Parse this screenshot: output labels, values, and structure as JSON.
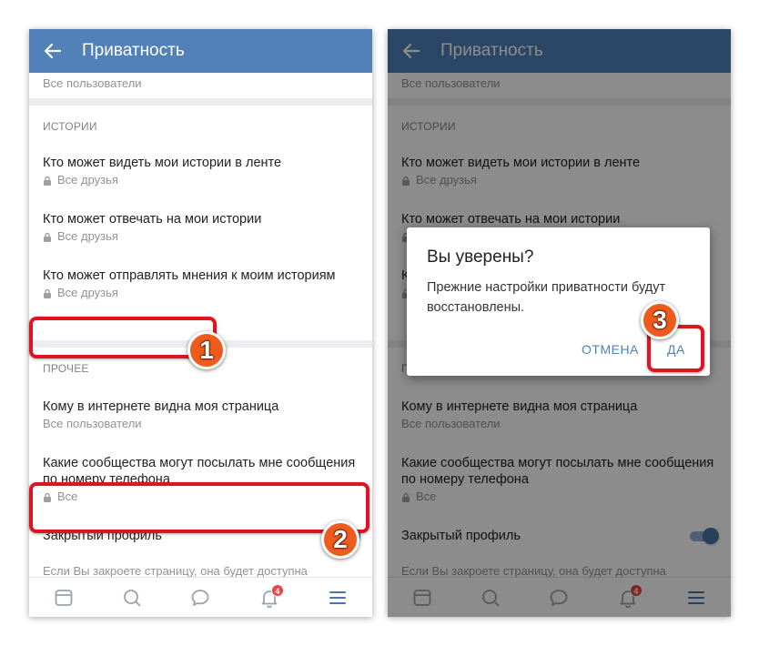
{
  "colors": {
    "appbar": "#5181b8",
    "accent": "#4a76a8",
    "highlight": "#e0141e",
    "marker": "#ef5b1c",
    "badge": "#e64646"
  },
  "appbar": {
    "title": "Приватность",
    "back_icon": "arrow-left-icon"
  },
  "top_item_sub": "Все пользователи",
  "stories": {
    "header": "ИСТОРИИ",
    "items": [
      {
        "title": "Кто может видеть мои истории в ленте",
        "sub": "Все друзья"
      },
      {
        "title": "Кто может отвечать на мои истории",
        "sub": "Все друзья"
      },
      {
        "title": "Кто может отправлять мнения к моим историям",
        "sub": "Все друзья"
      }
    ]
  },
  "other": {
    "header": "ПРОЧЕЕ",
    "page_visible": {
      "title": "Кому в интернете видна моя страница",
      "sub": "Все пользователи"
    },
    "communities": {
      "title": "Какие сообщества могут посылать мне сообщения по номеру телефона",
      "sub": "Все"
    },
    "closed_profile": {
      "title": "Закрытый профиль",
      "enabled": true
    },
    "hint": "Если Вы закроете страницу, она будет доступна только Вашим друзьям."
  },
  "bottom_nav": {
    "icons": [
      "newsfeed-icon",
      "search-icon",
      "messages-icon",
      "notifications-icon",
      "menu-icon"
    ],
    "notifications_badge": "4"
  },
  "dialog": {
    "title": "Вы уверены?",
    "message": "Прежние настройки приватности будут восстановлены.",
    "cancel_label": "ОТМЕНА",
    "confirm_label": "ДА"
  },
  "markers": [
    "1",
    "2",
    "3"
  ]
}
